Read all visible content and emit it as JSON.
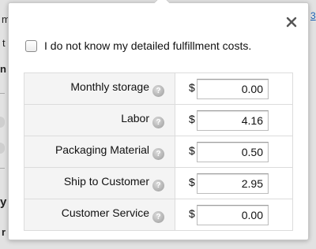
{
  "background": {
    "fragment_m": "m",
    "fragment_t": "t",
    "fragment_n": "n",
    "fragment_y": "y",
    "fragment_r": "r",
    "link_fragment": "3"
  },
  "popover": {
    "close_symbol": "×",
    "option_label": "I do not know my detailed fulfillment costs.",
    "option_checked": false,
    "currency_symbol": "$",
    "help_symbol": "?",
    "rows": [
      {
        "label": "Monthly storage",
        "value": "0.00"
      },
      {
        "label": "Labor",
        "value": "4.16"
      },
      {
        "label": "Packaging Material",
        "value": "0.50"
      },
      {
        "label": "Ship to Customer",
        "value": "2.95"
      },
      {
        "label": "Customer Service",
        "value": "0.00"
      }
    ]
  }
}
